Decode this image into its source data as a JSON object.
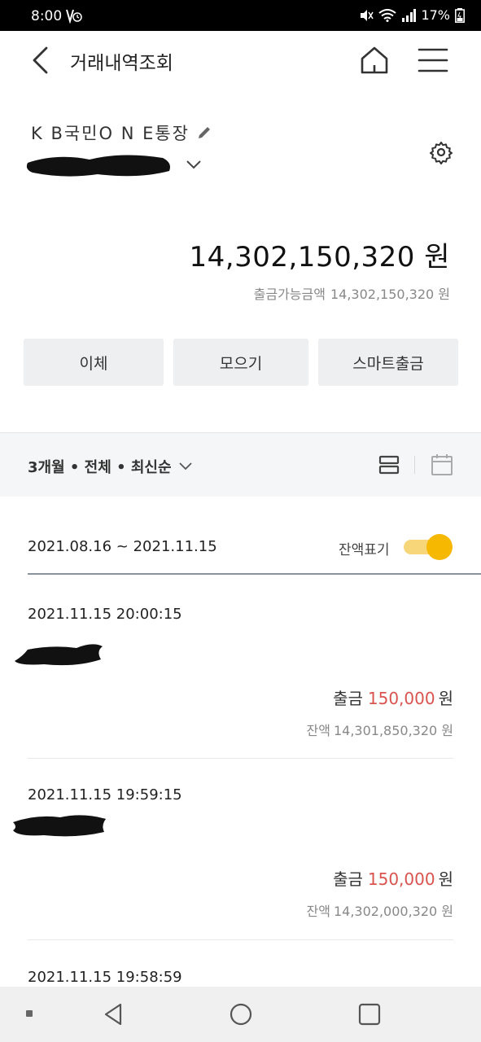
{
  "status_bar": {
    "time": "8:00",
    "battery": "17%"
  },
  "header": {
    "title": "거래내역조회"
  },
  "account": {
    "name": "K B국민O N E통장",
    "balance": "14,302,150,320 원",
    "available_label": "출금가능금액",
    "available_amount": "14,302,150,320 원"
  },
  "actions": {
    "transfer": "이체",
    "collect": "모으기",
    "smart_withdraw": "스마트출금"
  },
  "filter": {
    "label": "3개월 • 전체 • 최신순"
  },
  "date_range": {
    "text": "2021.08.16 ~ 2021.11.15",
    "balance_toggle_label": "잔액표기",
    "balance_toggle_on": true
  },
  "transactions": [
    {
      "datetime": "2021.11.15 20:00:15",
      "type": "출금",
      "amount": "150,000",
      "currency": "원",
      "balance_label": "잔액",
      "balance": "14,301,850,320 원"
    },
    {
      "datetime": "2021.11.15 19:59:15",
      "type": "출금",
      "amount": "150,000",
      "currency": "원",
      "balance_label": "잔액",
      "balance": "14,302,000,320 원"
    },
    {
      "datetime": "2021.11.15 19:58:59"
    }
  ],
  "colors": {
    "accent_toggle": "#f6b800",
    "withdraw_amount": "#d9534f",
    "button_bg": "#edeff1"
  }
}
